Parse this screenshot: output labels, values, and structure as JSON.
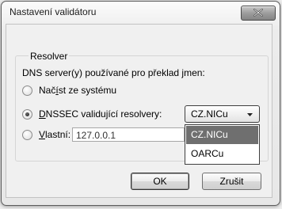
{
  "dialog": {
    "title": "Nastavení validátoru",
    "close_icon": "close-x-icon"
  },
  "resolver_group": {
    "label": "Resolver",
    "description": "DNS server(y) používané pro překlad jmen:",
    "options": [
      {
        "prefix": "Nač",
        "accel": "í",
        "suffix": "st ze systému",
        "checked": false
      },
      {
        "prefix": "",
        "accel": "D",
        "suffix": "NSSEC validující resolvery:",
        "checked": true
      },
      {
        "prefix": "",
        "accel": "V",
        "suffix": "lastní:",
        "checked": false
      }
    ],
    "custom_value": "127.0.0.1"
  },
  "resolver_select": {
    "selected": "CZ.NICu",
    "options": [
      "CZ.NICu",
      "OARCu"
    ],
    "highlighted_index": 0
  },
  "buttons": {
    "ok": "OK",
    "cancel": "Zrušit"
  }
}
